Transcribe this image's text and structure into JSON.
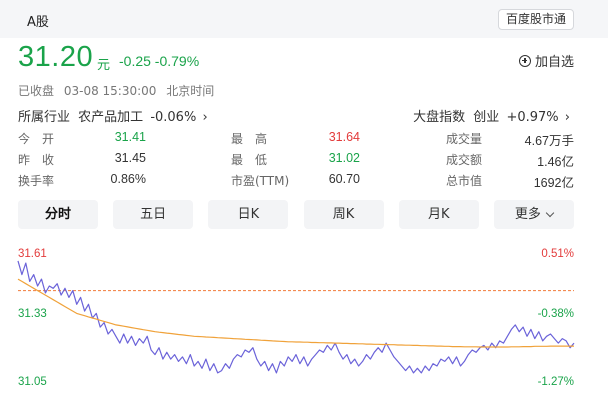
{
  "header": {
    "market_tag": "A股",
    "source_badge": "百度股市通"
  },
  "quote": {
    "price": "31.20",
    "unit": "元",
    "change": "-0.25 -0.79%",
    "add_watchlist": "加自选",
    "status": "已收盘",
    "datetime": "03-08 15:30:00",
    "timezone": "北京时间"
  },
  "industry": {
    "label": "所属行业",
    "name": "农产品加工",
    "change": "-0.06%"
  },
  "index": {
    "label": "大盘指数",
    "name": "创业",
    "change": "+0.97%"
  },
  "stats": {
    "open": {
      "label": "今　开",
      "value": "31.41"
    },
    "prev_close": {
      "label": "昨　收",
      "value": "31.45"
    },
    "turnover": {
      "label": "换手率",
      "value": "0.86%"
    },
    "high": {
      "label": "最　高",
      "value": "31.64"
    },
    "low": {
      "label": "最　低",
      "value": "31.02"
    },
    "pe": {
      "label": "市盈(TTM)",
      "value": "60.70"
    },
    "volume": {
      "label": "成交量",
      "value": "4.67万手"
    },
    "amount": {
      "label": "成交额",
      "value": "1.46亿"
    },
    "market_cap": {
      "label": "总市值",
      "value": "1692亿"
    }
  },
  "tabs": {
    "intraday": "分时",
    "five_day": "五日",
    "daily": "日K",
    "weekly": "周K",
    "monthly": "月K",
    "more": "更多"
  },
  "chart_data": {
    "type": "line",
    "y_left_ticks": [
      "31.61",
      "31.33",
      "31.05"
    ],
    "y_right_ticks": [
      "0.51%",
      "-0.38%",
      "-1.27%"
    ],
    "ylim": [
      31.05,
      31.61
    ],
    "prev_close": 31.45,
    "colors": {
      "price": "#6b63d9",
      "average": "#f0a23a",
      "prev_close": "#f07b3a",
      "up": "#e33b3b",
      "down": "#1aa34a"
    },
    "series": [
      {
        "role": "price",
        "values": [
          31.58,
          31.52,
          31.57,
          31.49,
          31.52,
          31.47,
          31.5,
          31.44,
          31.47,
          31.46,
          31.48,
          31.43,
          31.46,
          31.42,
          31.45,
          31.39,
          31.42,
          31.36,
          31.39,
          31.33,
          31.35,
          31.29,
          31.31,
          31.26,
          31.28,
          31.25,
          31.22,
          31.26,
          31.22,
          31.25,
          31.21,
          31.24,
          31.22,
          31.25,
          31.19,
          31.17,
          31.2,
          31.15,
          31.18,
          31.15,
          31.17,
          31.14,
          31.16,
          31.13,
          31.17,
          31.12,
          31.14,
          31.11,
          31.15,
          31.1,
          31.13,
          31.09,
          31.1,
          31.13,
          31.11,
          31.15,
          31.17,
          31.16,
          31.19,
          31.18,
          31.2,
          31.15,
          31.12,
          31.14,
          31.1,
          31.13,
          31.09,
          31.14,
          31.12,
          31.16,
          31.14,
          31.17,
          31.13,
          31.16,
          31.12,
          31.15,
          31.17,
          31.19,
          31.18,
          31.21,
          31.19,
          31.22,
          31.18,
          31.15,
          31.17,
          31.13,
          31.15,
          31.12,
          31.14,
          31.17,
          31.15,
          31.18,
          31.2,
          31.18,
          31.22,
          31.19,
          31.16,
          31.14,
          31.12,
          31.1,
          31.12,
          31.09,
          31.11,
          31.09,
          31.12,
          31.1,
          31.13,
          31.12,
          31.15,
          31.14,
          31.16,
          31.13,
          31.16,
          31.12,
          31.14,
          31.17,
          31.19,
          31.18,
          31.2,
          31.21,
          31.19,
          31.22,
          31.2,
          31.23,
          31.22,
          31.25,
          31.28,
          31.3,
          31.27,
          31.29,
          31.25,
          31.28,
          31.24,
          31.27,
          31.23,
          31.25,
          31.26,
          31.24,
          31.22,
          31.24,
          31.23,
          31.2,
          31.22
        ]
      },
      {
        "role": "average",
        "values": [
          31.5,
          31.49,
          31.48,
          31.47,
          31.46,
          31.45,
          31.44,
          31.43,
          31.42,
          31.41,
          31.4,
          31.39,
          31.38,
          31.37,
          31.36,
          31.35,
          31.345,
          31.34,
          31.335,
          31.33,
          31.325,
          31.32,
          31.315,
          31.31,
          31.305,
          31.3,
          31.297,
          31.294,
          31.291,
          31.288,
          31.285,
          31.282,
          31.279,
          31.276,
          31.273,
          31.27,
          31.268,
          31.266,
          31.264,
          31.262,
          31.26,
          31.258,
          31.256,
          31.254,
          31.252,
          31.25,
          31.249,
          31.248,
          31.247,
          31.246,
          31.245,
          31.244,
          31.243,
          31.242,
          31.241,
          31.24,
          31.239,
          31.238,
          31.237,
          31.236,
          31.235,
          31.234,
          31.233,
          31.232,
          31.231,
          31.23,
          31.229,
          31.228,
          31.227,
          31.226,
          31.226,
          31.225,
          31.225,
          31.224,
          31.224,
          31.223,
          31.223,
          31.222,
          31.222,
          31.221,
          31.221,
          31.22,
          31.22,
          31.219,
          31.219,
          31.218,
          31.218,
          31.217,
          31.217,
          31.216,
          31.216,
          31.215,
          31.215,
          31.214,
          31.214,
          31.213,
          31.213,
          31.212,
          31.212,
          31.211,
          31.211,
          31.21,
          31.21,
          31.209,
          31.209,
          31.208,
          31.208,
          31.207,
          31.207,
          31.206,
          31.206,
          31.205,
          31.205,
          31.205,
          31.204,
          31.204,
          31.204,
          31.204,
          31.203,
          31.203,
          31.203,
          31.203,
          31.203,
          31.203,
          31.203,
          31.203,
          31.204,
          31.204,
          31.204,
          31.205,
          31.205,
          31.205,
          31.206,
          31.206,
          31.206,
          31.206,
          31.207,
          31.207,
          31.207,
          31.207,
          31.207,
          31.207,
          31.207
        ]
      }
    ]
  }
}
